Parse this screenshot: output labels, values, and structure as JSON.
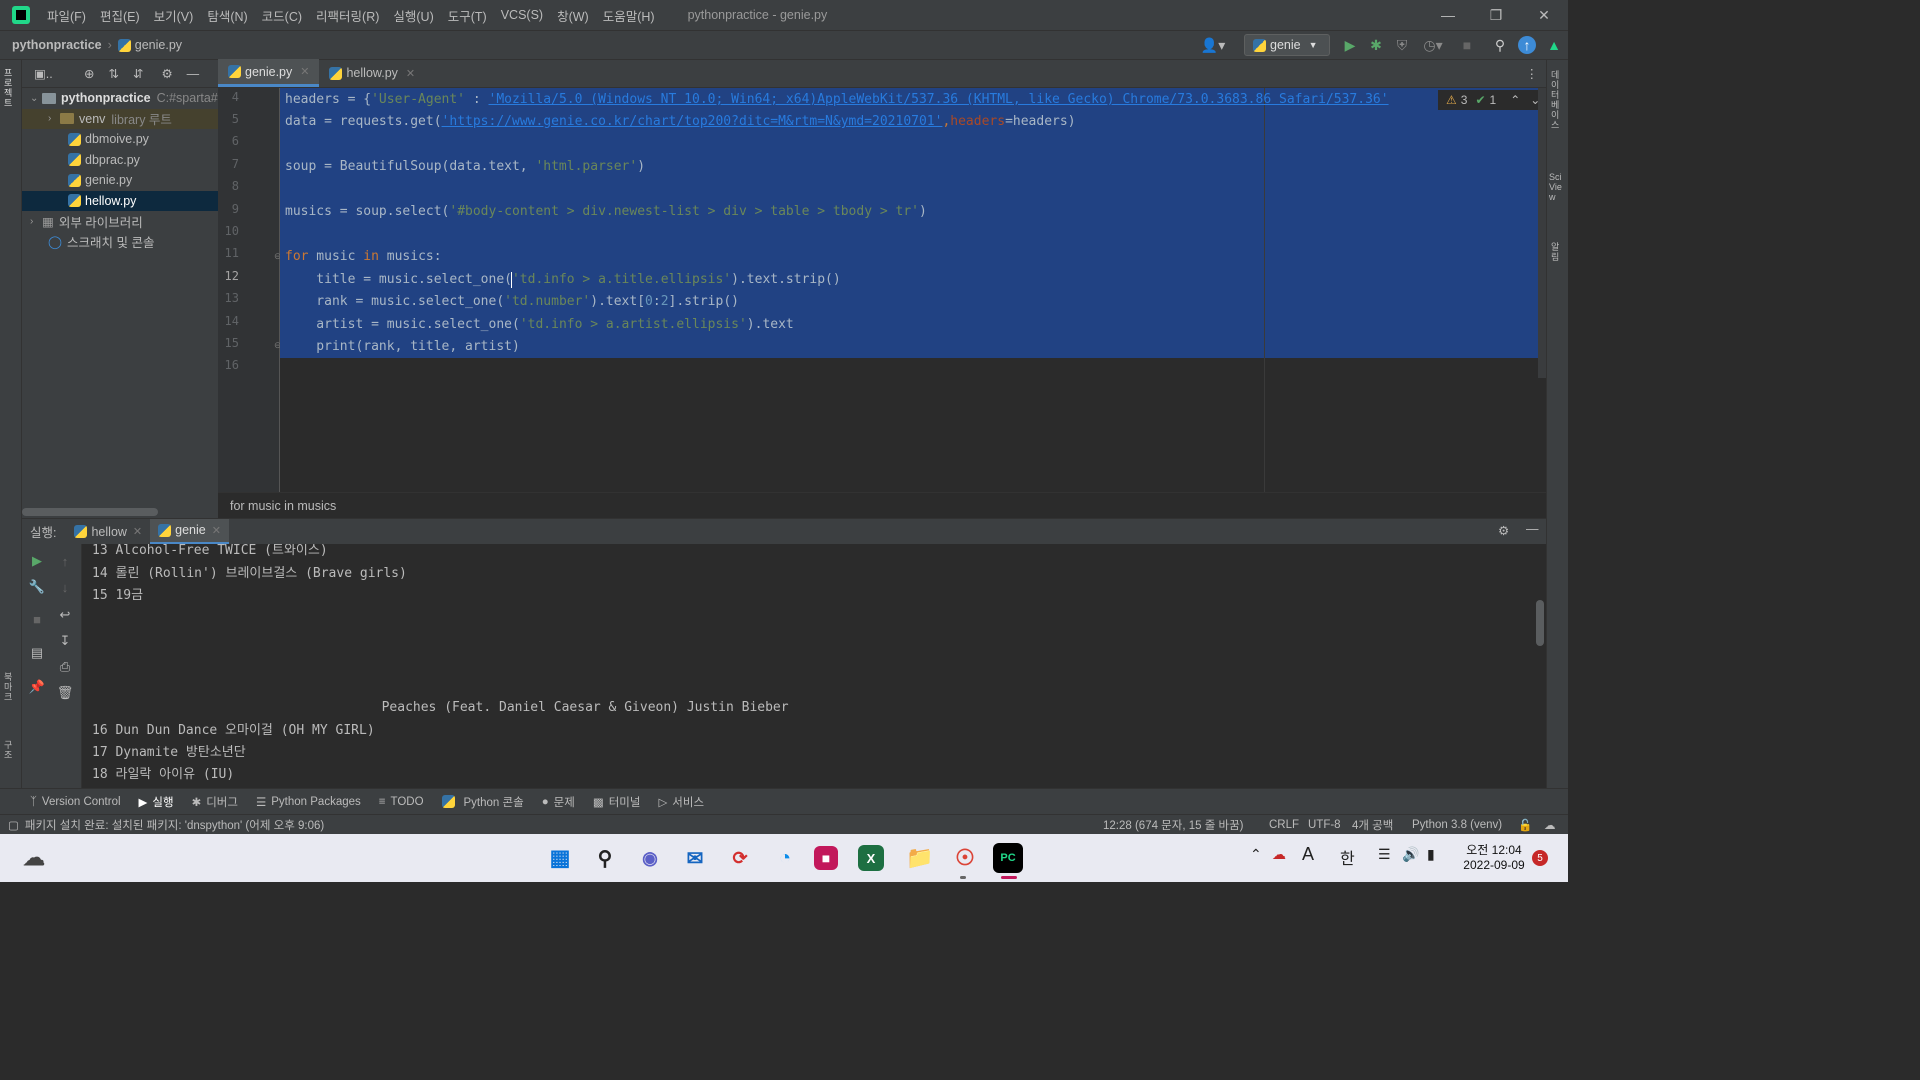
{
  "window": {
    "title": "pythonpractice - genie.py",
    "menu": [
      "파일(F)",
      "편집(E)",
      "보기(V)",
      "탐색(N)",
      "코드(C)",
      "리팩터링(R)",
      "실행(U)",
      "도구(T)",
      "VCS(S)",
      "창(W)",
      "도움말(H)"
    ]
  },
  "navbar": {
    "project": "pythonpractice",
    "file": "genie.py",
    "run_config": "genie"
  },
  "project_tree": {
    "root": "pythonpractice",
    "root_path": "C:#sparta#",
    "venv": "venv",
    "venv_note": "library 루트",
    "files": [
      "dbmoive.py",
      "dbprac.py",
      "genie.py",
      "hellow.py"
    ],
    "external": "외부 라이브러리",
    "scratches": "스크래치 및 콘솔"
  },
  "editor": {
    "tabs": [
      "genie.py",
      "hellow.py"
    ],
    "line_numbers": [
      "4",
      "5",
      "6",
      "7",
      "8",
      "9",
      "10",
      "11",
      "12",
      "13",
      "14",
      "15",
      "16"
    ],
    "warnings": "3",
    "checks": "1",
    "code": {
      "l4_a": "headers = {",
      "l4_b": "'User-Agent'",
      "l4_c": " : ",
      "l4_d": "'Mozilla/5.0 (Windows NT 10.0; Win64; x64)AppleWebKit/537.36 (KHTML, like Gecko) Chrome/73.0.3683.86 Safari/537.36'",
      "l5_a": "data = requests.get(",
      "l5_b": "'https://www.genie.co.kr/chart/top200?ditc=M&rtm=N&ymd=20210701'",
      "l5_c": ",",
      "l5_d": "headers",
      "l5_e": "=headers)",
      "l7_a": "soup = BeautifulSoup(data.text, ",
      "l7_b": "'html.parser'",
      "l7_c": ")",
      "l9_a": "musics = soup.select(",
      "l9_b": "'#body-content > div.newest-list > div > table > tbody > tr'",
      "l9_c": ")",
      "l11_a": "for",
      "l11_b": " music ",
      "l11_c": "in",
      "l11_d": " musics:",
      "l12_a": "    title = music.select_one(",
      "l12_b": "'td.info > a.title.ellipsis'",
      "l12_c": ").text.strip()",
      "l13_a": "    rank = music.select_one(",
      "l13_b": "'td.number'",
      "l13_c": ").text[",
      "l13_d": "0",
      "l13_e": ":",
      "l13_f": "2",
      "l13_g": "].strip()",
      "l14_a": "    artist = music.select_one(",
      "l14_b": "'td.info > a.artist.ellipsis'",
      "l14_c": ").text",
      "l15_a": "    print(rank, title, artist)"
    },
    "breadcrumb": "for music in musics"
  },
  "run": {
    "label": "실행:",
    "tabs": [
      "hellow",
      "genie"
    ],
    "output": [
      "13 Alcohol-Free TWICE (트와이스)",
      "14 롤린 (Rollin') 브레이브걸스 (Brave girls)",
      "15 19금",
      "",
      "",
      "",
      "",
      "                                     Peaches (Feat. Daniel Caesar & Giveon) Justin Bieber",
      "16 Dun Dun Dance 오마이걸 (OH MY GIRL)",
      "17 Dynamite 방탄소년단",
      "18 라일락 아이유 (IU)"
    ]
  },
  "toolwindows": [
    "Version Control",
    "실행",
    "디버그",
    "Python Packages",
    "TODO",
    "Python 콘솔",
    "문제",
    "터미널",
    "서비스"
  ],
  "status": {
    "message": "패키지 설치 완료: 설치된 패키지: 'dnspython' (어제 오후 9:06)",
    "position": "12:28 (674 문자, 15 줄 바꿈)",
    "line_sep": "CRLF",
    "encoding": "UTF-8",
    "indent": "4개 공백",
    "interpreter": "Python 3.8 (venv)"
  },
  "taskbar": {
    "time": "오전 12:04",
    "date": "2022-09-09",
    "ime_a": "A",
    "ime_k": "한",
    "badge": "5"
  },
  "side_labels": {
    "left_top": "프로젝트",
    "left_mid": "북마크",
    "left_bot": "구조",
    "right_top": "데이터베이스",
    "right_mid": "SciView",
    "right_bot": "알림"
  },
  "colors": {
    "selection": "#214283",
    "accent": "#4a88c7",
    "run_green": "#59a869"
  }
}
